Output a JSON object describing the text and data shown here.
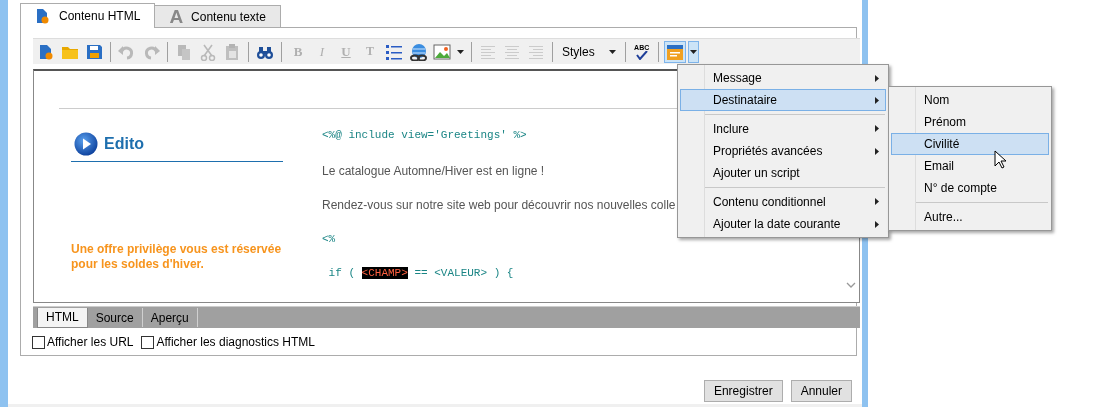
{
  "tabs": [
    {
      "label": "Contenu HTML",
      "selected": true
    },
    {
      "label": "Contenu texte",
      "selected": false,
      "icon_letter": "A"
    }
  ],
  "toolbar": {
    "groups": [
      [
        {
          "kind": "icon",
          "disabled": false
        },
        {
          "kind": "icon",
          "disabled": false
        },
        {
          "kind": "icon",
          "disabled": false
        }
      ],
      [
        {
          "kind": "icon",
          "disabled": true
        },
        {
          "kind": "icon",
          "disabled": true
        }
      ],
      [
        {
          "kind": "icon",
          "disabled": true
        },
        {
          "kind": "icon",
          "disabled": true
        },
        {
          "kind": "icon",
          "disabled": true
        }
      ],
      [
        {
          "kind": "icon",
          "disabled": false
        }
      ],
      [
        {
          "kind": "letter",
          "label": "B",
          "disabled": true
        },
        {
          "kind": "letter",
          "label": "I",
          "disabled": true
        },
        {
          "kind": "letter",
          "label": "U",
          "disabled": true
        },
        {
          "kind": "letter",
          "label": "T",
          "disabled": true
        },
        {
          "kind": "icon",
          "disabled": false
        },
        {
          "kind": "icon",
          "disabled": false
        },
        {
          "kind": "split",
          "disabled": false,
          "pressed": false
        }
      ],
      [
        {
          "kind": "icon",
          "disabled": true
        },
        {
          "kind": "icon",
          "disabled": true
        },
        {
          "kind": "icon",
          "disabled": true
        }
      ],
      [
        {
          "kind": "dropdown",
          "label": "Styles"
        }
      ],
      [
        {
          "kind": "spell",
          "label": "ABC",
          "disabled": false
        }
      ],
      [
        {
          "kind": "split",
          "disabled": false,
          "pressed": true
        }
      ]
    ]
  },
  "editor": {
    "heading": "Edito",
    "promo_lines": [
      "Une offre privilège vous est réservée",
      "pour les soldes d'hiver."
    ],
    "lines": [
      {
        "kind": "code",
        "segments": [
          {
            "text": "<%@ include view='Greetings' %>",
            "highlighted": false
          }
        ]
      },
      {
        "kind": "text",
        "segments": [
          {
            "text": "Le catalogue Automne/Hiver est en ligne !",
            "highlighted": false
          }
        ]
      },
      {
        "kind": "text",
        "segments": [
          {
            "text": "Rendez-vous sur notre site web pour découvrir nos nouvelles colle",
            "highlighted": false
          }
        ]
      },
      {
        "kind": "code",
        "segments": [
          {
            "text": "<%",
            "highlighted": false
          }
        ]
      },
      {
        "kind": "code",
        "segments": [
          {
            "text": " if ( ",
            "highlighted": false
          },
          {
            "text": "<CHAMP>",
            "highlighted": true
          },
          {
            "text": " == <VALEUR> ) {",
            "highlighted": false
          }
        ]
      }
    ]
  },
  "view_tabs": [
    {
      "label": "HTML",
      "selected": true
    },
    {
      "label": "Source",
      "selected": false
    },
    {
      "label": "Aperçu",
      "selected": false
    }
  ],
  "options": [
    {
      "label": "Afficher les URL",
      "checked": false
    },
    {
      "label": "Afficher les diagnostics HTML",
      "checked": false
    }
  ],
  "buttons": [
    "Enregistrer",
    "Annuler"
  ],
  "menu": {
    "items": [
      {
        "label": "Message",
        "submenu": true,
        "selected": false
      },
      {
        "label": "Destinataire",
        "submenu": true,
        "selected": true
      },
      {
        "label": "Inclure",
        "submenu": true,
        "selected": false,
        "separator_before": true
      },
      {
        "label": "Propriétés avancées",
        "submenu": true,
        "selected": false
      },
      {
        "label": "Ajouter un script",
        "submenu": false,
        "selected": false
      },
      {
        "label": "Contenu conditionnel",
        "submenu": true,
        "selected": false,
        "separator_before": true
      },
      {
        "label": "Ajouter la date courante",
        "submenu": true,
        "selected": false
      }
    ]
  },
  "submenu": {
    "items": [
      {
        "label": "Nom",
        "submenu": false,
        "selected": false
      },
      {
        "label": "Prénom",
        "submenu": false,
        "selected": false
      },
      {
        "label": "Civilité",
        "submenu": false,
        "selected": true
      },
      {
        "label": "Email",
        "submenu": false,
        "selected": false
      },
      {
        "label": "N° de compte",
        "submenu": false,
        "selected": false
      },
      {
        "label": "Autre...",
        "submenu": false,
        "selected": false,
        "separator_before": true
      }
    ]
  }
}
